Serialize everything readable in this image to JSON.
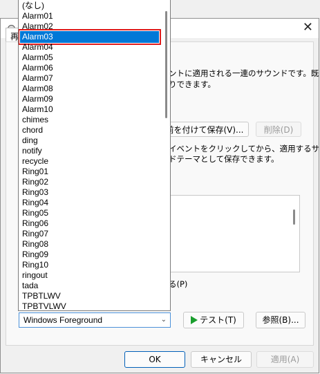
{
  "tab": {
    "label": "再"
  },
  "description": {
    "line1": "ントに適用される一連のサウンドです。既",
    "line2": "りできます。",
    "line3": "イベントをクリックしてから、適用するサウ",
    "line4": "ドテーマとして保存できます。",
    "play_label": "る(P)"
  },
  "buttons": {
    "save_as": "前を付けて保存(V)...",
    "delete": "削除(D)",
    "test": "テスト(T)",
    "browse": "参照(B)...",
    "ok": "OK",
    "cancel": "キャンセル",
    "apply": "適用(A)"
  },
  "dropdown": {
    "selected_value": "Windows Foreground",
    "highlighted": "Alarm03",
    "items": [
      "(なし)",
      "Alarm01",
      "Alarm02",
      "Alarm03",
      "Alarm04",
      "Alarm05",
      "Alarm06",
      "Alarm07",
      "Alarm08",
      "Alarm09",
      "Alarm10",
      "chimes",
      "chord",
      "ding",
      "notify",
      "recycle",
      "Ring01",
      "Ring02",
      "Ring03",
      "Ring04",
      "Ring05",
      "Ring06",
      "Ring07",
      "Ring08",
      "Ring09",
      "Ring10",
      "ringout",
      "tada",
      "TPBTLWV",
      "TPBTVLWV"
    ]
  },
  "colors": {
    "selection": "#0078d7",
    "highlight_border": "#e01b1b",
    "accent": "#005fb8"
  },
  "icons": {
    "close": "close-icon",
    "app": "speaker-icon",
    "play": "play-icon",
    "chevron": "chevron-down-icon"
  }
}
